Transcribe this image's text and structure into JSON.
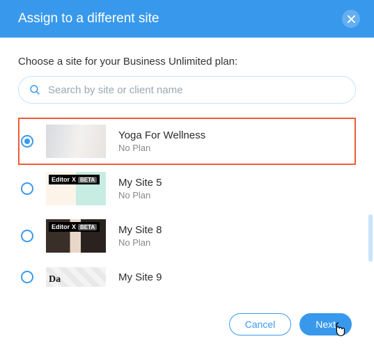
{
  "header": {
    "title": "Assign to a different site"
  },
  "prompt": "Choose a site for your Business Unlimited plan:",
  "search": {
    "placeholder": "Search by site or client name",
    "value": ""
  },
  "editorx_badge": {
    "label": "Editor",
    "x": "X",
    "beta": "BETA"
  },
  "sites": [
    {
      "name": "Yoga For Wellness",
      "plan": "No Plan",
      "selected": true,
      "badge": false
    },
    {
      "name": "My Site 5",
      "plan": "No Plan",
      "selected": false,
      "badge": true
    },
    {
      "name": "My Site 8",
      "plan": "No Plan",
      "selected": false,
      "badge": true
    },
    {
      "name": "My Site 9",
      "plan": "",
      "selected": false,
      "badge": false
    }
  ],
  "footer": {
    "cancel": "Cancel",
    "next": "Next"
  }
}
